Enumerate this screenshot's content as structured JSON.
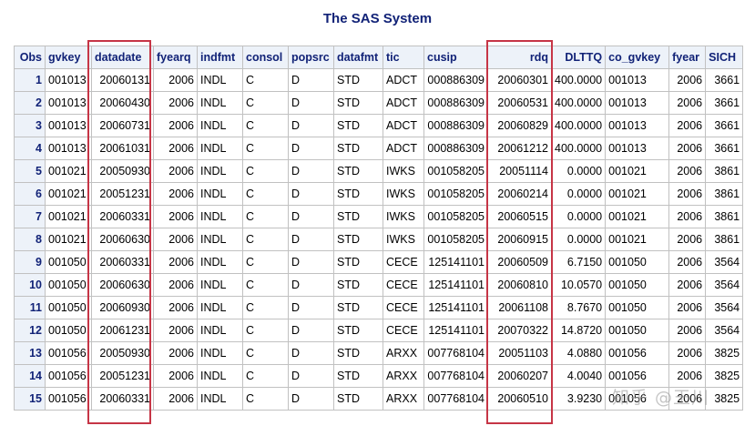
{
  "title": "The SAS System",
  "watermark": "知乎 @王川",
  "highlight_color": "#c63546",
  "header_color": "#112277",
  "columns": [
    "Obs",
    "gvkey",
    "datadate",
    "fyearq",
    "indfmt",
    "consol",
    "popsrc",
    "datafmt",
    "tic",
    "cusip",
    "rdq",
    "DLTTQ",
    "co_gvkey",
    "fyear",
    "SICH"
  ],
  "highlighted_columns": [
    "datadate",
    "rdq"
  ],
  "rows": [
    [
      "1",
      "001013",
      "20060131",
      "2006",
      "INDL",
      "C",
      "D",
      "STD",
      "ADCT",
      "000886309",
      "20060301",
      "400.0000",
      "001013",
      "2006",
      "3661"
    ],
    [
      "2",
      "001013",
      "20060430",
      "2006",
      "INDL",
      "C",
      "D",
      "STD",
      "ADCT",
      "000886309",
      "20060531",
      "400.0000",
      "001013",
      "2006",
      "3661"
    ],
    [
      "3",
      "001013",
      "20060731",
      "2006",
      "INDL",
      "C",
      "D",
      "STD",
      "ADCT",
      "000886309",
      "20060829",
      "400.0000",
      "001013",
      "2006",
      "3661"
    ],
    [
      "4",
      "001013",
      "20061031",
      "2006",
      "INDL",
      "C",
      "D",
      "STD",
      "ADCT",
      "000886309",
      "20061212",
      "400.0000",
      "001013",
      "2006",
      "3661"
    ],
    [
      "5",
      "001021",
      "20050930",
      "2006",
      "INDL",
      "C",
      "D",
      "STD",
      "IWKS",
      "001058205",
      "20051114",
      "0.0000",
      "001021",
      "2006",
      "3861"
    ],
    [
      "6",
      "001021",
      "20051231",
      "2006",
      "INDL",
      "C",
      "D",
      "STD",
      "IWKS",
      "001058205",
      "20060214",
      "0.0000",
      "001021",
      "2006",
      "3861"
    ],
    [
      "7",
      "001021",
      "20060331",
      "2006",
      "INDL",
      "C",
      "D",
      "STD",
      "IWKS",
      "001058205",
      "20060515",
      "0.0000",
      "001021",
      "2006",
      "3861"
    ],
    [
      "8",
      "001021",
      "20060630",
      "2006",
      "INDL",
      "C",
      "D",
      "STD",
      "IWKS",
      "001058205",
      "20060915",
      "0.0000",
      "001021",
      "2006",
      "3861"
    ],
    [
      "9",
      "001050",
      "20060331",
      "2006",
      "INDL",
      "C",
      "D",
      "STD",
      "CECE",
      "125141101",
      "20060509",
      "6.7150",
      "001050",
      "2006",
      "3564"
    ],
    [
      "10",
      "001050",
      "20060630",
      "2006",
      "INDL",
      "C",
      "D",
      "STD",
      "CECE",
      "125141101",
      "20060810",
      "10.0570",
      "001050",
      "2006",
      "3564"
    ],
    [
      "11",
      "001050",
      "20060930",
      "2006",
      "INDL",
      "C",
      "D",
      "STD",
      "CECE",
      "125141101",
      "20061108",
      "8.7670",
      "001050",
      "2006",
      "3564"
    ],
    [
      "12",
      "001050",
      "20061231",
      "2006",
      "INDL",
      "C",
      "D",
      "STD",
      "CECE",
      "125141101",
      "20070322",
      "14.8720",
      "001050",
      "2006",
      "3564"
    ],
    [
      "13",
      "001056",
      "20050930",
      "2006",
      "INDL",
      "C",
      "D",
      "STD",
      "ARXX",
      "007768104",
      "20051103",
      "4.0880",
      "001056",
      "2006",
      "3825"
    ],
    [
      "14",
      "001056",
      "20051231",
      "2006",
      "INDL",
      "C",
      "D",
      "STD",
      "ARXX",
      "007768104",
      "20060207",
      "4.0040",
      "001056",
      "2006",
      "3825"
    ],
    [
      "15",
      "001056",
      "20060331",
      "2006",
      "INDL",
      "C",
      "D",
      "STD",
      "ARXX",
      "007768104",
      "20060510",
      "3.9230",
      "001056",
      "2006",
      "3825"
    ]
  ]
}
